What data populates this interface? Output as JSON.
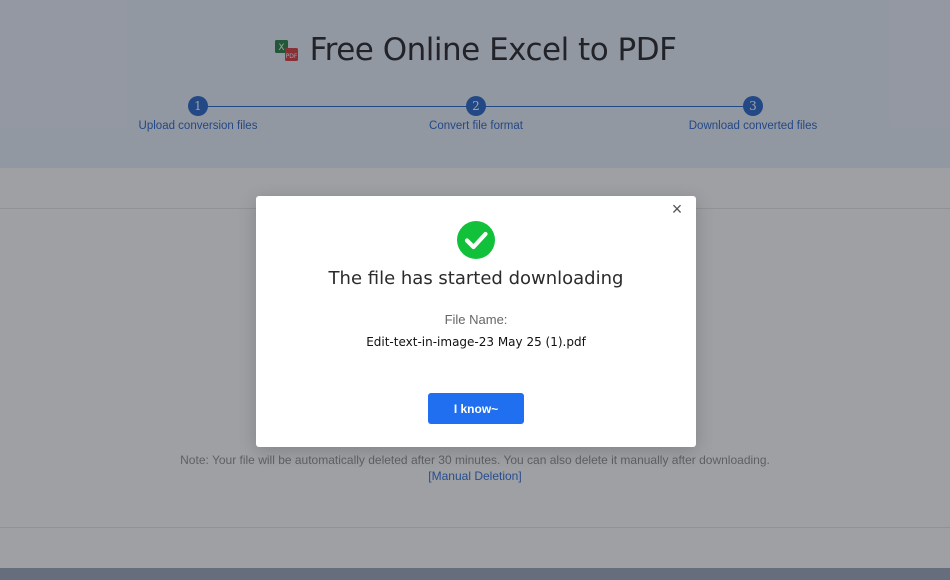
{
  "header": {
    "title": "Free Online Excel to PDF",
    "logo_icon": "excel-to-pdf-icon"
  },
  "steps": [
    {
      "number": "1",
      "label": "Upload conversion files"
    },
    {
      "number": "2",
      "label": "Convert file format"
    },
    {
      "number": "3",
      "label": "Download converted files"
    }
  ],
  "note": {
    "text": "Note: Your file will be automatically deleted after 30 minutes. You can also delete it manually after downloading.",
    "manual_link": "[Manual Deletion]"
  },
  "modal": {
    "close_symbol": "×",
    "headline": "The file has started downloading",
    "file_name_label": "File Name:",
    "file_name": "Edit-text-in-image-23 May 25 (1).pdf",
    "ok_button": "I know~"
  },
  "colors": {
    "accent": "#1f5fc8",
    "button": "#1f6ff0",
    "success": "#11c13a"
  }
}
